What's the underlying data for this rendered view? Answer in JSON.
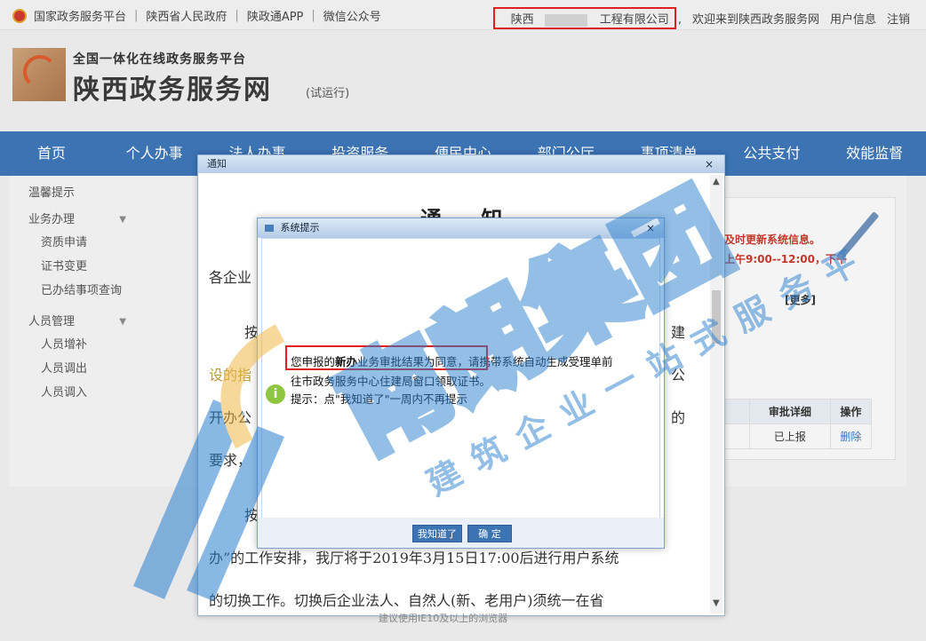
{
  "topbar": {
    "links": [
      "国家政务服务平台",
      "陕西省人民政府",
      "陕政通APP",
      "微信公众号"
    ],
    "company_prefix": "陕西",
    "company_suffix": "工程有限公司",
    "welcome": "欢迎来到陕西政务服务网",
    "user_info": "用户信息",
    "logout": "注销"
  },
  "header": {
    "subtitle": "全国一体化在线政务服务平台",
    "title": "陕西政务服务网",
    "trial": "(试运行)"
  },
  "nav": [
    "首页",
    "个人办事",
    "法人办事",
    "投资服务",
    "便民中心",
    "部门公厅",
    "事项清单",
    "公共支付",
    "效能监督"
  ],
  "sidebar": {
    "tips": "温馨提示",
    "business": "业务办理",
    "business_items": [
      "资质申请",
      "证书变更",
      "已办结事项查询"
    ],
    "personnel": "人员管理",
    "personnel_items": [
      "人员增补",
      "人员调出",
      "人员调入"
    ]
  },
  "right_panel": {
    "red_line1": "及时更新系统信息。",
    "red_line2": "上午9:00--12:00，下午",
    "more": "[更多]",
    "col_detail": "审批详细",
    "col_action": "操作",
    "row_status": "已上报",
    "row_action": "删除"
  },
  "notice": {
    "window_title": "通知",
    "close": "×",
    "heading": "通 知",
    "lines": [
      "各企业",
      "按",
      "建",
      "设的指",
      "公",
      "开办公",
      "的",
      "要求，",
      "按",
      "办”的工作安排，我厅将于2019年3月15日17:00后进行用户系统",
      "的切换工作。切换后企业法人、自然人(新、老用户)须统一在省"
    ],
    "below": "建议使用IE10及以上的浏览器"
  },
  "system_dialog": {
    "window_title": "系统提示",
    "close": "×",
    "msg_part1": "您申报的",
    "msg_bold": "新办",
    "msg_part2": "业务审批结果为同意",
    "msg_part3": "，请携带系统自动生成受理单前",
    "msg_line2": "往市政务服务中心住建局窗口领取证书。",
    "msg_line3": "提示：点\"我知道了\"一周内不再提示",
    "btn_know": "我知道了",
    "btn_ok": "确 定"
  },
  "watermark": {
    "main": "南朗集团",
    "sub": "建筑企业一站式服务平台"
  },
  "colors": {
    "nav_blue": "#3b73b3",
    "highlight_red": "#e02020",
    "watermark_blue": "#2a7fcf"
  }
}
